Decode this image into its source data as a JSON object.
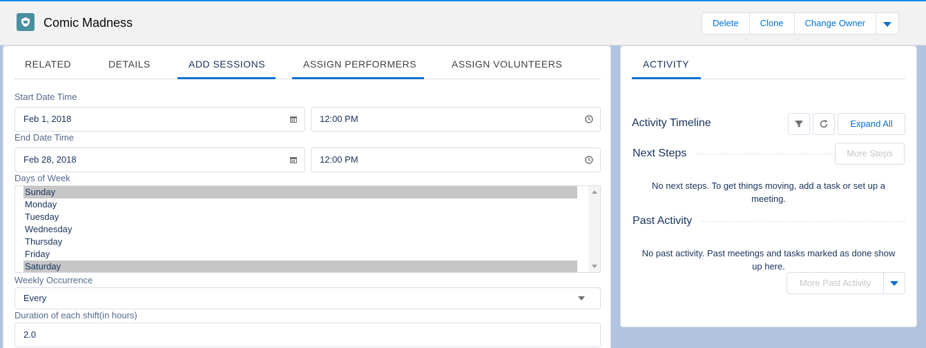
{
  "record": {
    "title": "Comic Madness",
    "icon": "record-type-icon"
  },
  "actions": {
    "delete": "Delete",
    "clone": "Clone",
    "change_owner": "Change Owner"
  },
  "tabs": [
    "Related",
    "Details",
    "Add Sessions",
    "Assign Performers",
    "Assign Volunteers"
  ],
  "form": {
    "start_label": "Start Date Time",
    "start_date": "Feb 1, 2018",
    "start_time": "12:00 PM",
    "end_label": "End Date Time",
    "end_date": "Feb 28, 2018",
    "end_time": "12:00 PM",
    "days_label": "Days of Week",
    "days": [
      "Sunday",
      "Monday",
      "Tuesday",
      "Wednesday",
      "Thursday",
      "Friday",
      "Saturday"
    ],
    "days_selected": [
      "Sunday",
      "Saturday"
    ],
    "weekly_label": "Weekly Occurrence",
    "weekly_value": "Every",
    "duration_label": "Duration of each shift(in hours)",
    "duration_value": "2.0"
  },
  "activity": {
    "tab": "Activity",
    "timeline_title": "Activity Timeline",
    "expand_all": "Expand All",
    "next_steps_title": "Next Steps",
    "more_steps": "More Steps",
    "next_steps_empty_1": "No next steps. To get things moving, add a task or set up a",
    "next_steps_empty_2": "meeting.",
    "past_title": "Past Activity",
    "past_empty_1": "No past activity. Past meetings and tasks marked as done show",
    "past_empty_2": "up here.",
    "more_past": "More Past Activity"
  },
  "colors": {
    "brand": "#0070d2",
    "record_icon": "#4a8f9e",
    "selected_option": "#c6c6c6"
  }
}
